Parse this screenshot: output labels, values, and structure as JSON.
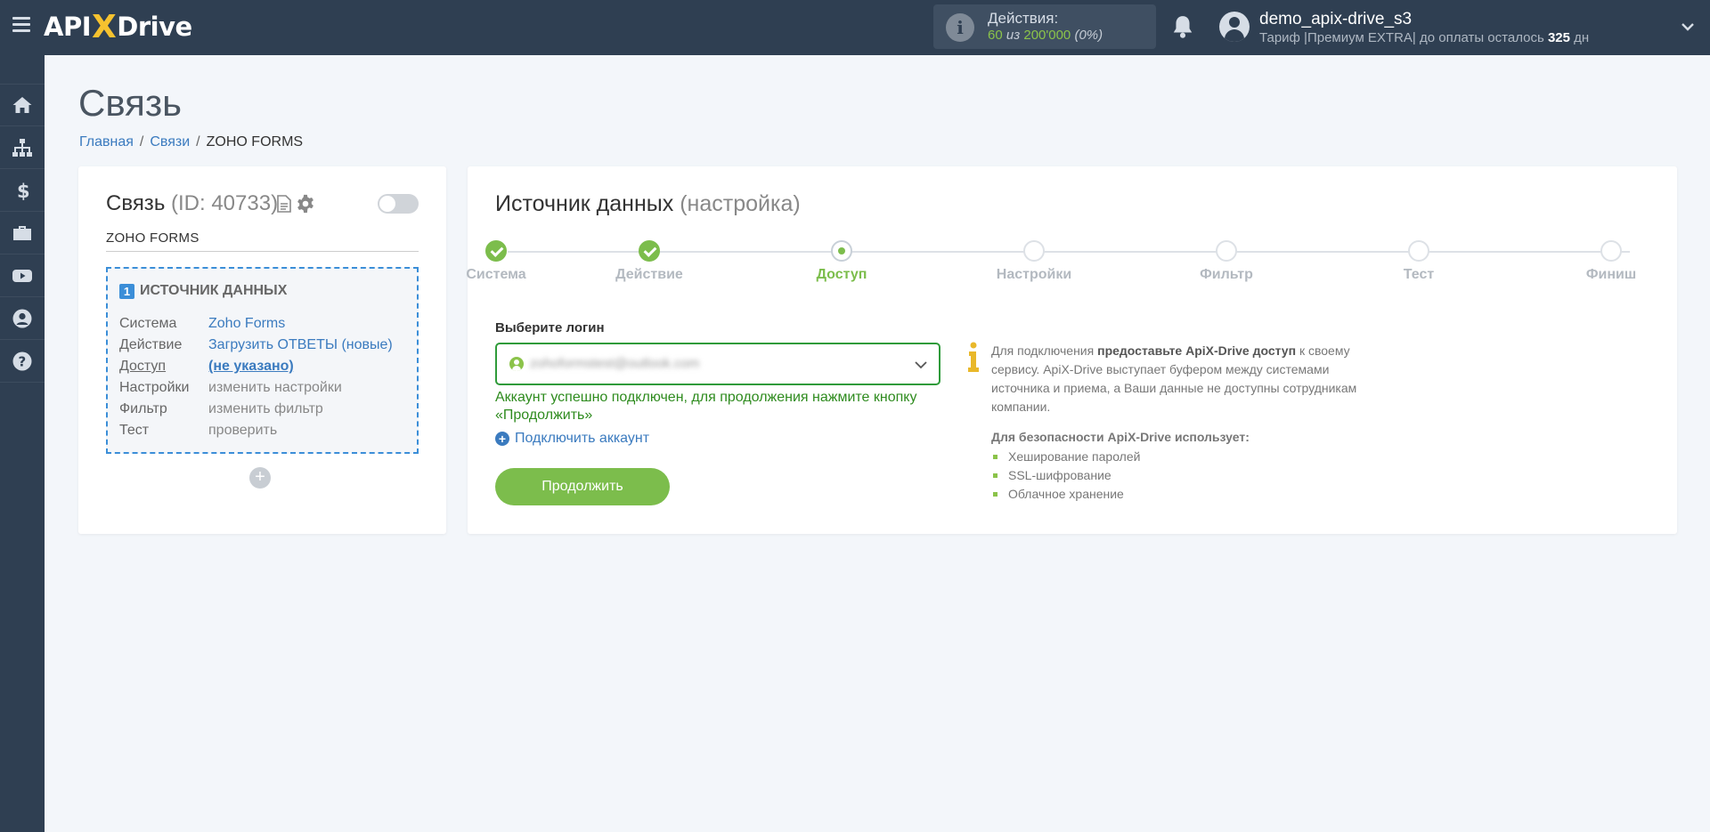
{
  "header": {
    "logo_left": "API",
    "logo_x": "X",
    "logo_right": "Drive",
    "actions_label": "Действия:",
    "actions_used": "60",
    "actions_of": "из",
    "actions_total": "200'000",
    "actions_percent": "(0%)",
    "username": "demo_apix-drive_s3",
    "plan_prefix": "Тариф |Премиум EXTRA| до оплаты осталось",
    "plan_days": "325",
    "plan_suffix": "дн"
  },
  "sidebar": {
    "items": [
      "home-icon",
      "sitemap-icon",
      "dollar-icon",
      "briefcase-icon",
      "youtube-icon",
      "user-icon",
      "help-icon"
    ]
  },
  "page": {
    "title": "Связь",
    "breadcrumb": [
      "Главная",
      "Связи",
      "ZOHO FORMS"
    ]
  },
  "connection": {
    "title": "Связь",
    "id_text": "(ID: 40733)",
    "name": "ZOHO FORMS",
    "enabled": false,
    "source": {
      "number": "1",
      "heading": "ИСТОЧНИК ДАННЫХ",
      "rows": [
        {
          "label": "Система",
          "value": "Zoho Forms"
        },
        {
          "label": "Действие",
          "value": "Загрузить ОТВЕТЫ (новые)"
        },
        {
          "label": "Доступ",
          "value": "(не указано)"
        },
        {
          "label": "Настройки",
          "value": "изменить настройки"
        },
        {
          "label": "Фильтр",
          "value": "изменить фильтр"
        },
        {
          "label": "Тест",
          "value": "проверить"
        }
      ]
    },
    "add_symbol": "+"
  },
  "source_setup": {
    "title": "Источник данных",
    "subtitle": "(настройка)",
    "steps": [
      {
        "label": "Система",
        "state": "done"
      },
      {
        "label": "Действие",
        "state": "done"
      },
      {
        "label": "Доступ",
        "state": "active"
      },
      {
        "label": "Настройки",
        "state": "todo"
      },
      {
        "label": "Фильтр",
        "state": "todo"
      },
      {
        "label": "Тест",
        "state": "todo"
      },
      {
        "label": "Финиш",
        "state": "todo"
      }
    ],
    "login_label": "Выберите логин",
    "login_value": "zohoformstest@outlook.com",
    "success_message": "Аккаунт успешно подключен, для продолжения нажмите кнопку «Продолжить»",
    "connect_account": "Подключить аккаунт",
    "continue_button": "Продолжить",
    "hint_part1": "Для подключения ",
    "hint_bold": "предоставьте ApiX-Drive доступ",
    "hint_part2": " к своему сервису. ApiX-Drive выступает буфером между системами источника и приема, а Ваши данные не доступны сотрудникам компании.",
    "security_title": "Для безопасности ApiX-Drive использует:",
    "security_items": [
      "Хеширование паролей",
      "SSL-шифрование",
      "Облачное хранение"
    ]
  },
  "colors": {
    "topbar": "#2f3f52",
    "accent_green": "#7cbd4c",
    "link_blue": "#3b7bbf",
    "success_green": "#2e8b1e"
  }
}
